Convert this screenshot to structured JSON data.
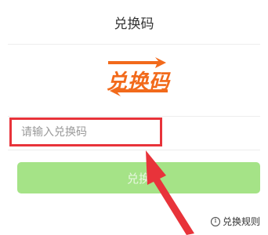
{
  "header": {
    "title": "兑换码"
  },
  "logo": {
    "text": "兑换码",
    "color": "#f26a1b"
  },
  "form": {
    "code_input": {
      "placeholder": "请输入兑换码",
      "value": ""
    },
    "submit_label": "兑换"
  },
  "footer": {
    "rules_icon": "info-icon",
    "rules_label": "兑换规则"
  },
  "colors": {
    "highlight_red": "#e8333a",
    "button_green": "#a5e387",
    "logo_orange": "#f26a1b"
  }
}
